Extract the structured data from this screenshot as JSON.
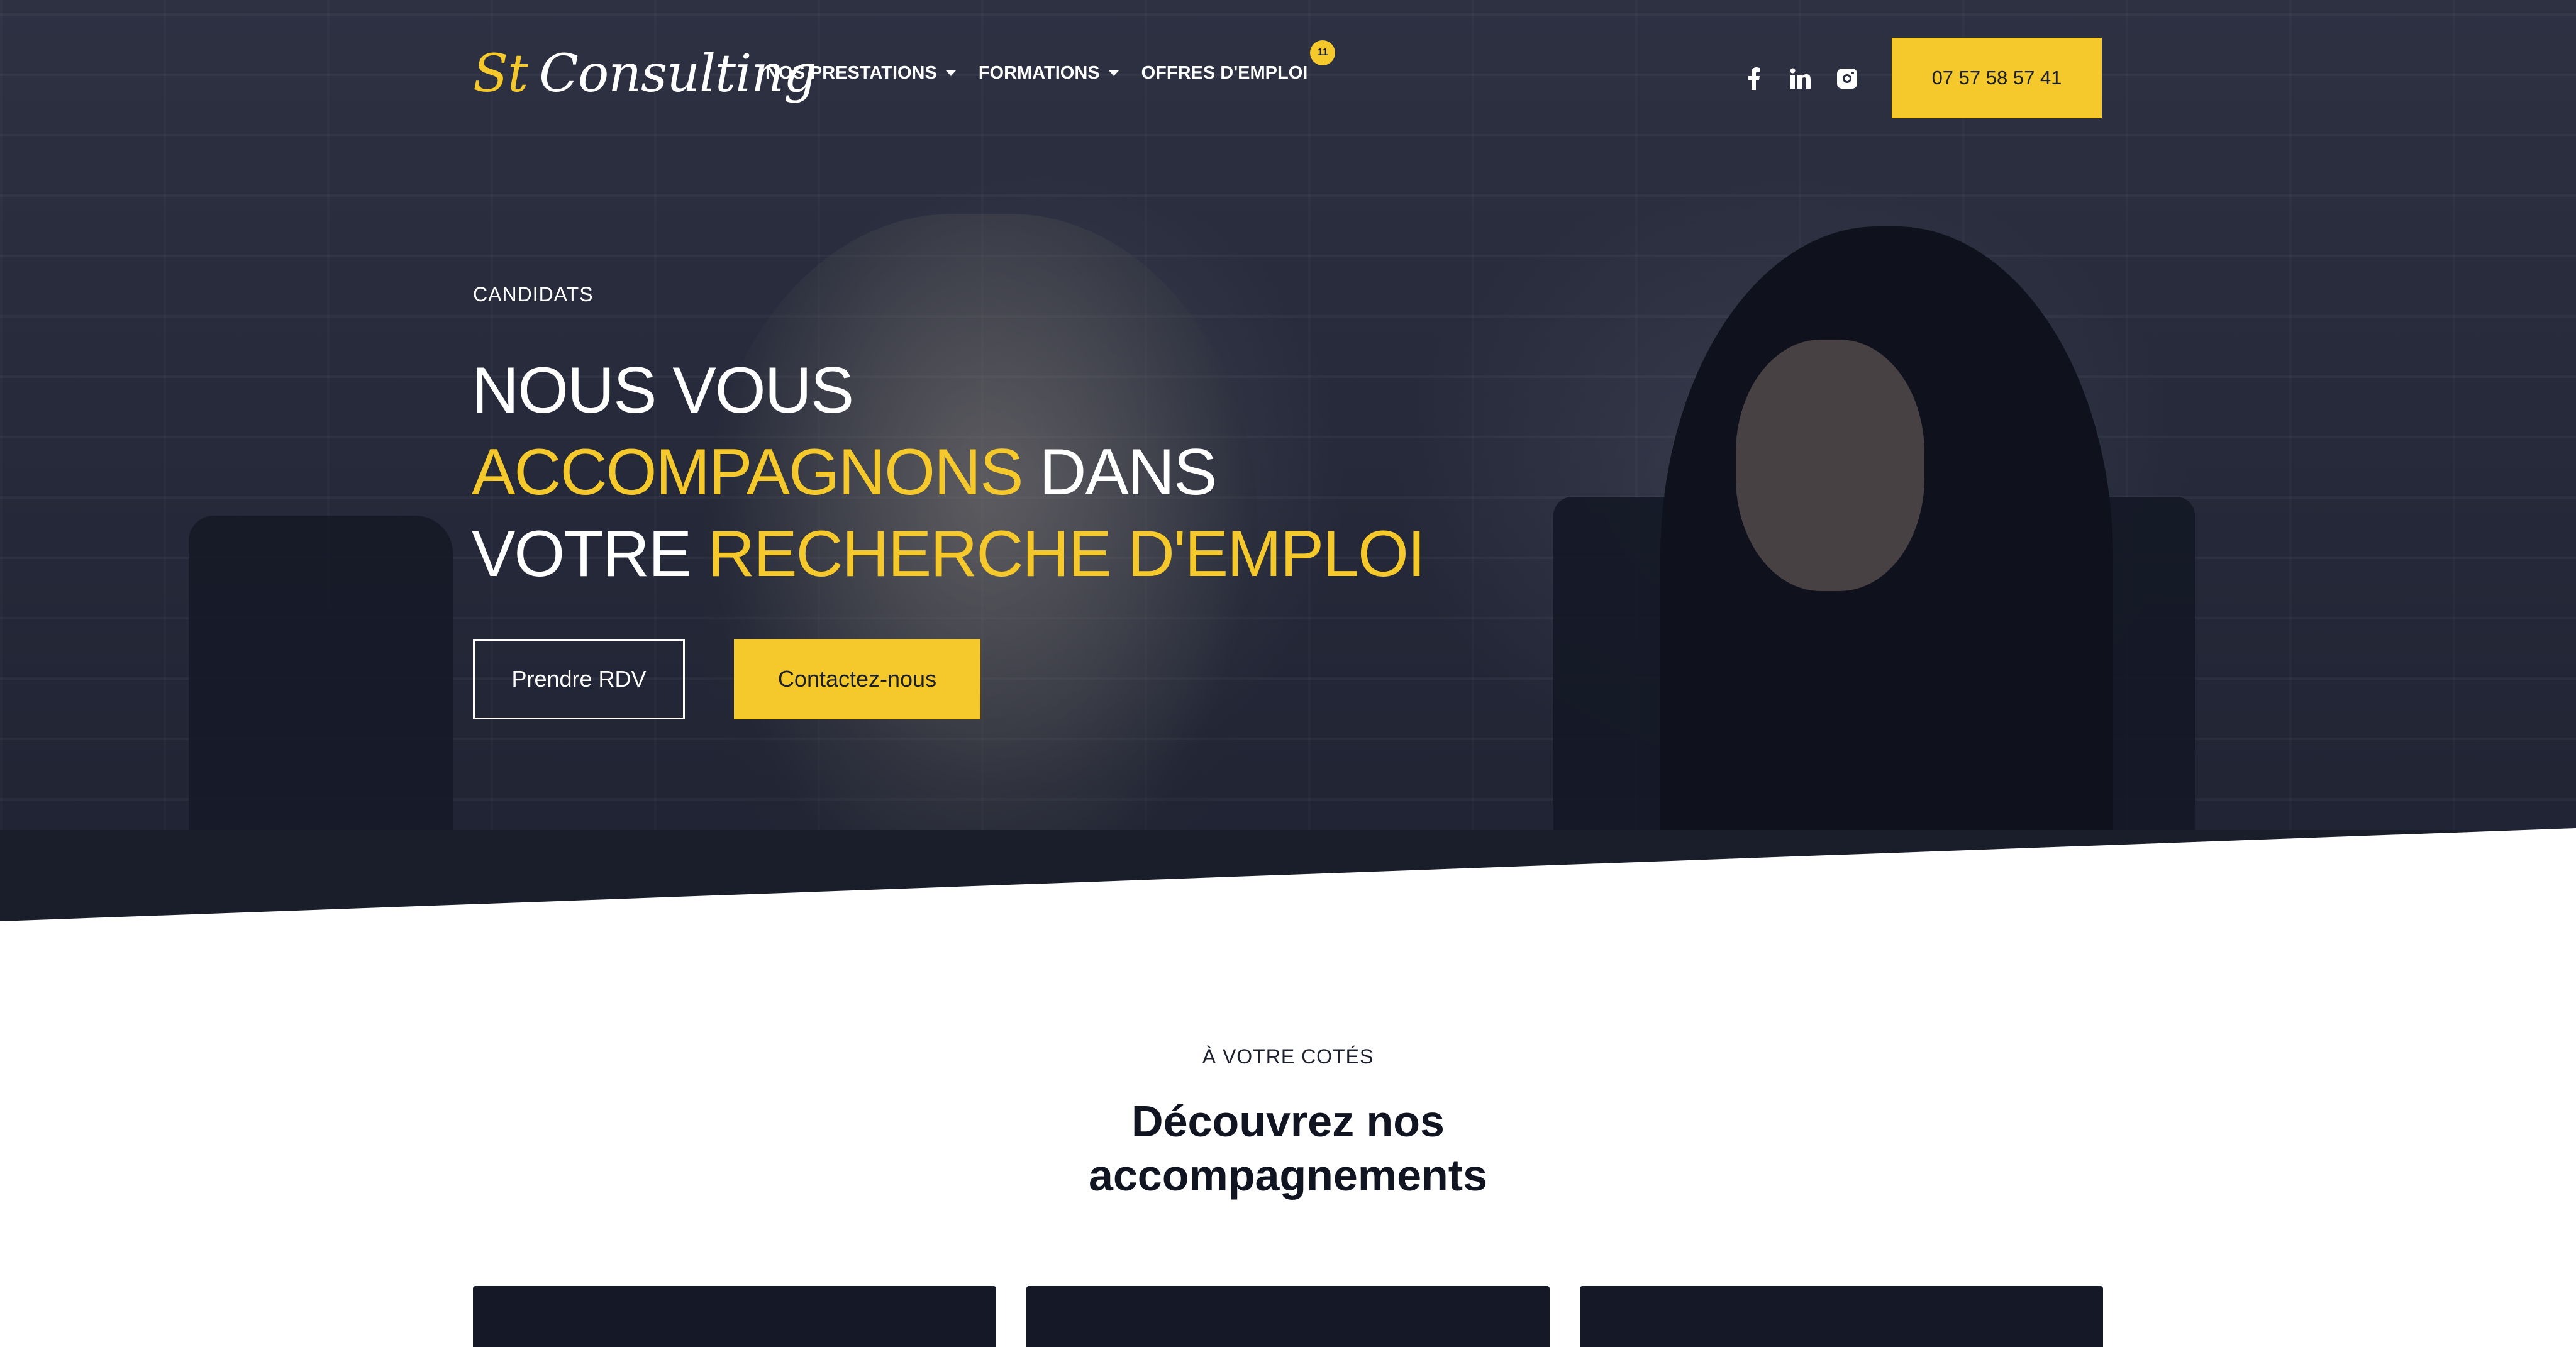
{
  "header": {
    "logo": {
      "part1": "St",
      "part2": "Consulting"
    },
    "nav": [
      {
        "label": "NOS PRESTATIONS",
        "has_dropdown": true
      },
      {
        "label": "FORMATIONS",
        "has_dropdown": true
      },
      {
        "label": "OFFRES D'EMPLOI",
        "has_dropdown": false,
        "badge": "11"
      }
    ],
    "socials": [
      "facebook-icon",
      "linkedin-icon",
      "instagram-icon"
    ],
    "phone_label": "07 57 58 57 41"
  },
  "hero": {
    "eyebrow": "CANDIDATS",
    "line1": "NOUS VOUS",
    "line2_accent": "ACCOMPAGNONS",
    "line2_rest": " DANS",
    "line3_start": "VOTRE ",
    "line3_accent": "RECHERCHE D'EMPLOI",
    "btn_primary": "Prendre RDV",
    "btn_secondary": "Contactez-nous"
  },
  "section": {
    "eyebrow": "À VOTRE COTÉS",
    "title_line1": "Découvrez nos",
    "title_line2": "accompagnements"
  },
  "colors": {
    "accent": "#f5c92b",
    "dark": "#1c1f2c",
    "card": "#141827"
  }
}
